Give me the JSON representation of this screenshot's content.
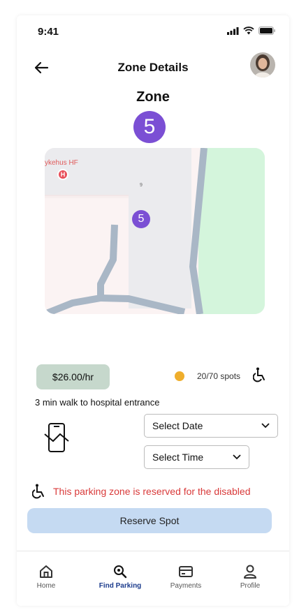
{
  "status_bar": {
    "time": "9:41"
  },
  "header": {
    "title": "Zone Details"
  },
  "zone": {
    "label": "Zone",
    "number": "5"
  },
  "map": {
    "poi_label": "ykehus HF",
    "poi_badge": "H",
    "marker_number": "5",
    "small_label": "9"
  },
  "info": {
    "price": "$26.00/hr",
    "spots": "20/70 spots",
    "walk": "3 min walk to hospital entrance",
    "availability_color": "#efae2c"
  },
  "selects": {
    "date": "Select Date",
    "time": "Select Time"
  },
  "notice": "This parking zone is reserved for the disabled",
  "reserve_button": "Reserve Spot",
  "nav": {
    "items": [
      {
        "label": "Home",
        "icon": "home-icon"
      },
      {
        "label": "Find Parking",
        "icon": "search-icon",
        "active": true
      },
      {
        "label": "Payments",
        "icon": "card-icon"
      },
      {
        "label": "Profile",
        "icon": "user-icon"
      }
    ]
  },
  "colors": {
    "accent": "#7b4fd4",
    "notice": "#d93a3a",
    "button": "#c5daf2",
    "price_bg": "#c6d8cc",
    "nav_active": "#1b3b8c"
  }
}
